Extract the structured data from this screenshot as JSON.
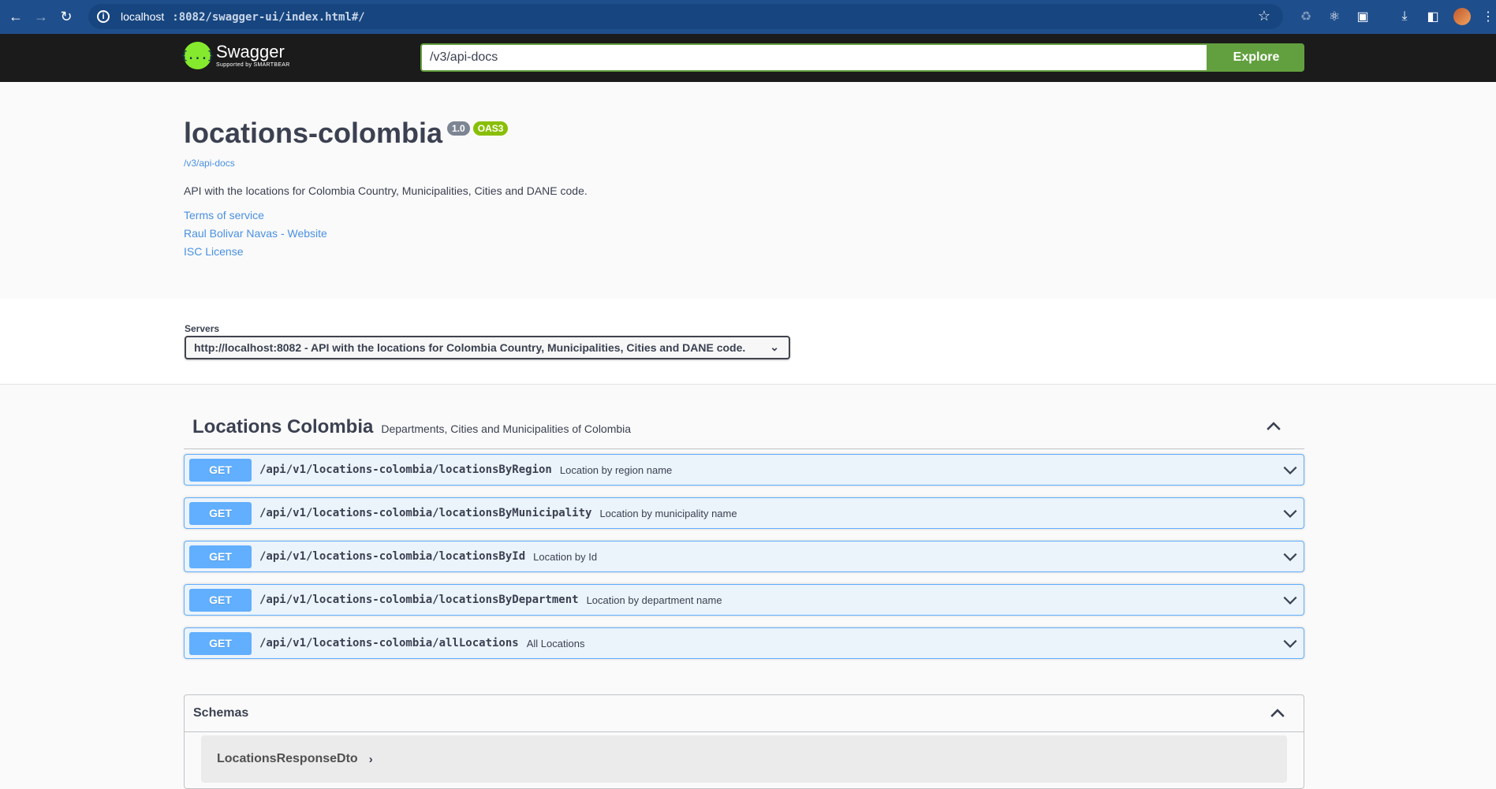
{
  "browser": {
    "url_host": "localhost",
    "url_path": ":8082/swagger-ui/index.html#/"
  },
  "topbar": {
    "logo_title": "Swagger",
    "logo_sub": "Supported by SMARTBEAR",
    "logo_glyph": "{...}",
    "api_url": "/v3/api-docs",
    "explore_label": "Explore"
  },
  "info": {
    "title": "locations-colombia",
    "version": "1.0",
    "oas": "OAS3",
    "spec_link": "/v3/api-docs",
    "description": "API with the locations for Colombia Country, Municipalities, Cities and DANE code.",
    "links": [
      "Terms of service",
      "Raul Bolivar Navas - Website",
      "ISC License"
    ]
  },
  "servers": {
    "label": "Servers",
    "selected": "http://localhost:8082 - API with the locations for Colombia Country, Municipalities, Cities and DANE code."
  },
  "tag": {
    "name": "Locations Colombia",
    "description": "Departments, Cities and Municipalities of Colombia"
  },
  "operations": [
    {
      "method": "GET",
      "path": "/api/v1/locations-colombia/locationsByRegion",
      "summary": "Location by region name"
    },
    {
      "method": "GET",
      "path": "/api/v1/locations-colombia/locationsByMunicipality",
      "summary": "Location by municipality name"
    },
    {
      "method": "GET",
      "path": "/api/v1/locations-colombia/locationsById",
      "summary": "Location by Id"
    },
    {
      "method": "GET",
      "path": "/api/v1/locations-colombia/locationsByDepartment",
      "summary": "Location by department name"
    },
    {
      "method": "GET",
      "path": "/api/v1/locations-colombia/allLocations",
      "summary": "All Locations"
    }
  ],
  "schemas": {
    "title": "Schemas",
    "models": [
      "LocationsResponseDto"
    ]
  },
  "colors": {
    "get_blue": "#61affe",
    "explore_green": "#62a03f",
    "link_blue": "#4990e2",
    "oas_green": "#89bf04"
  }
}
